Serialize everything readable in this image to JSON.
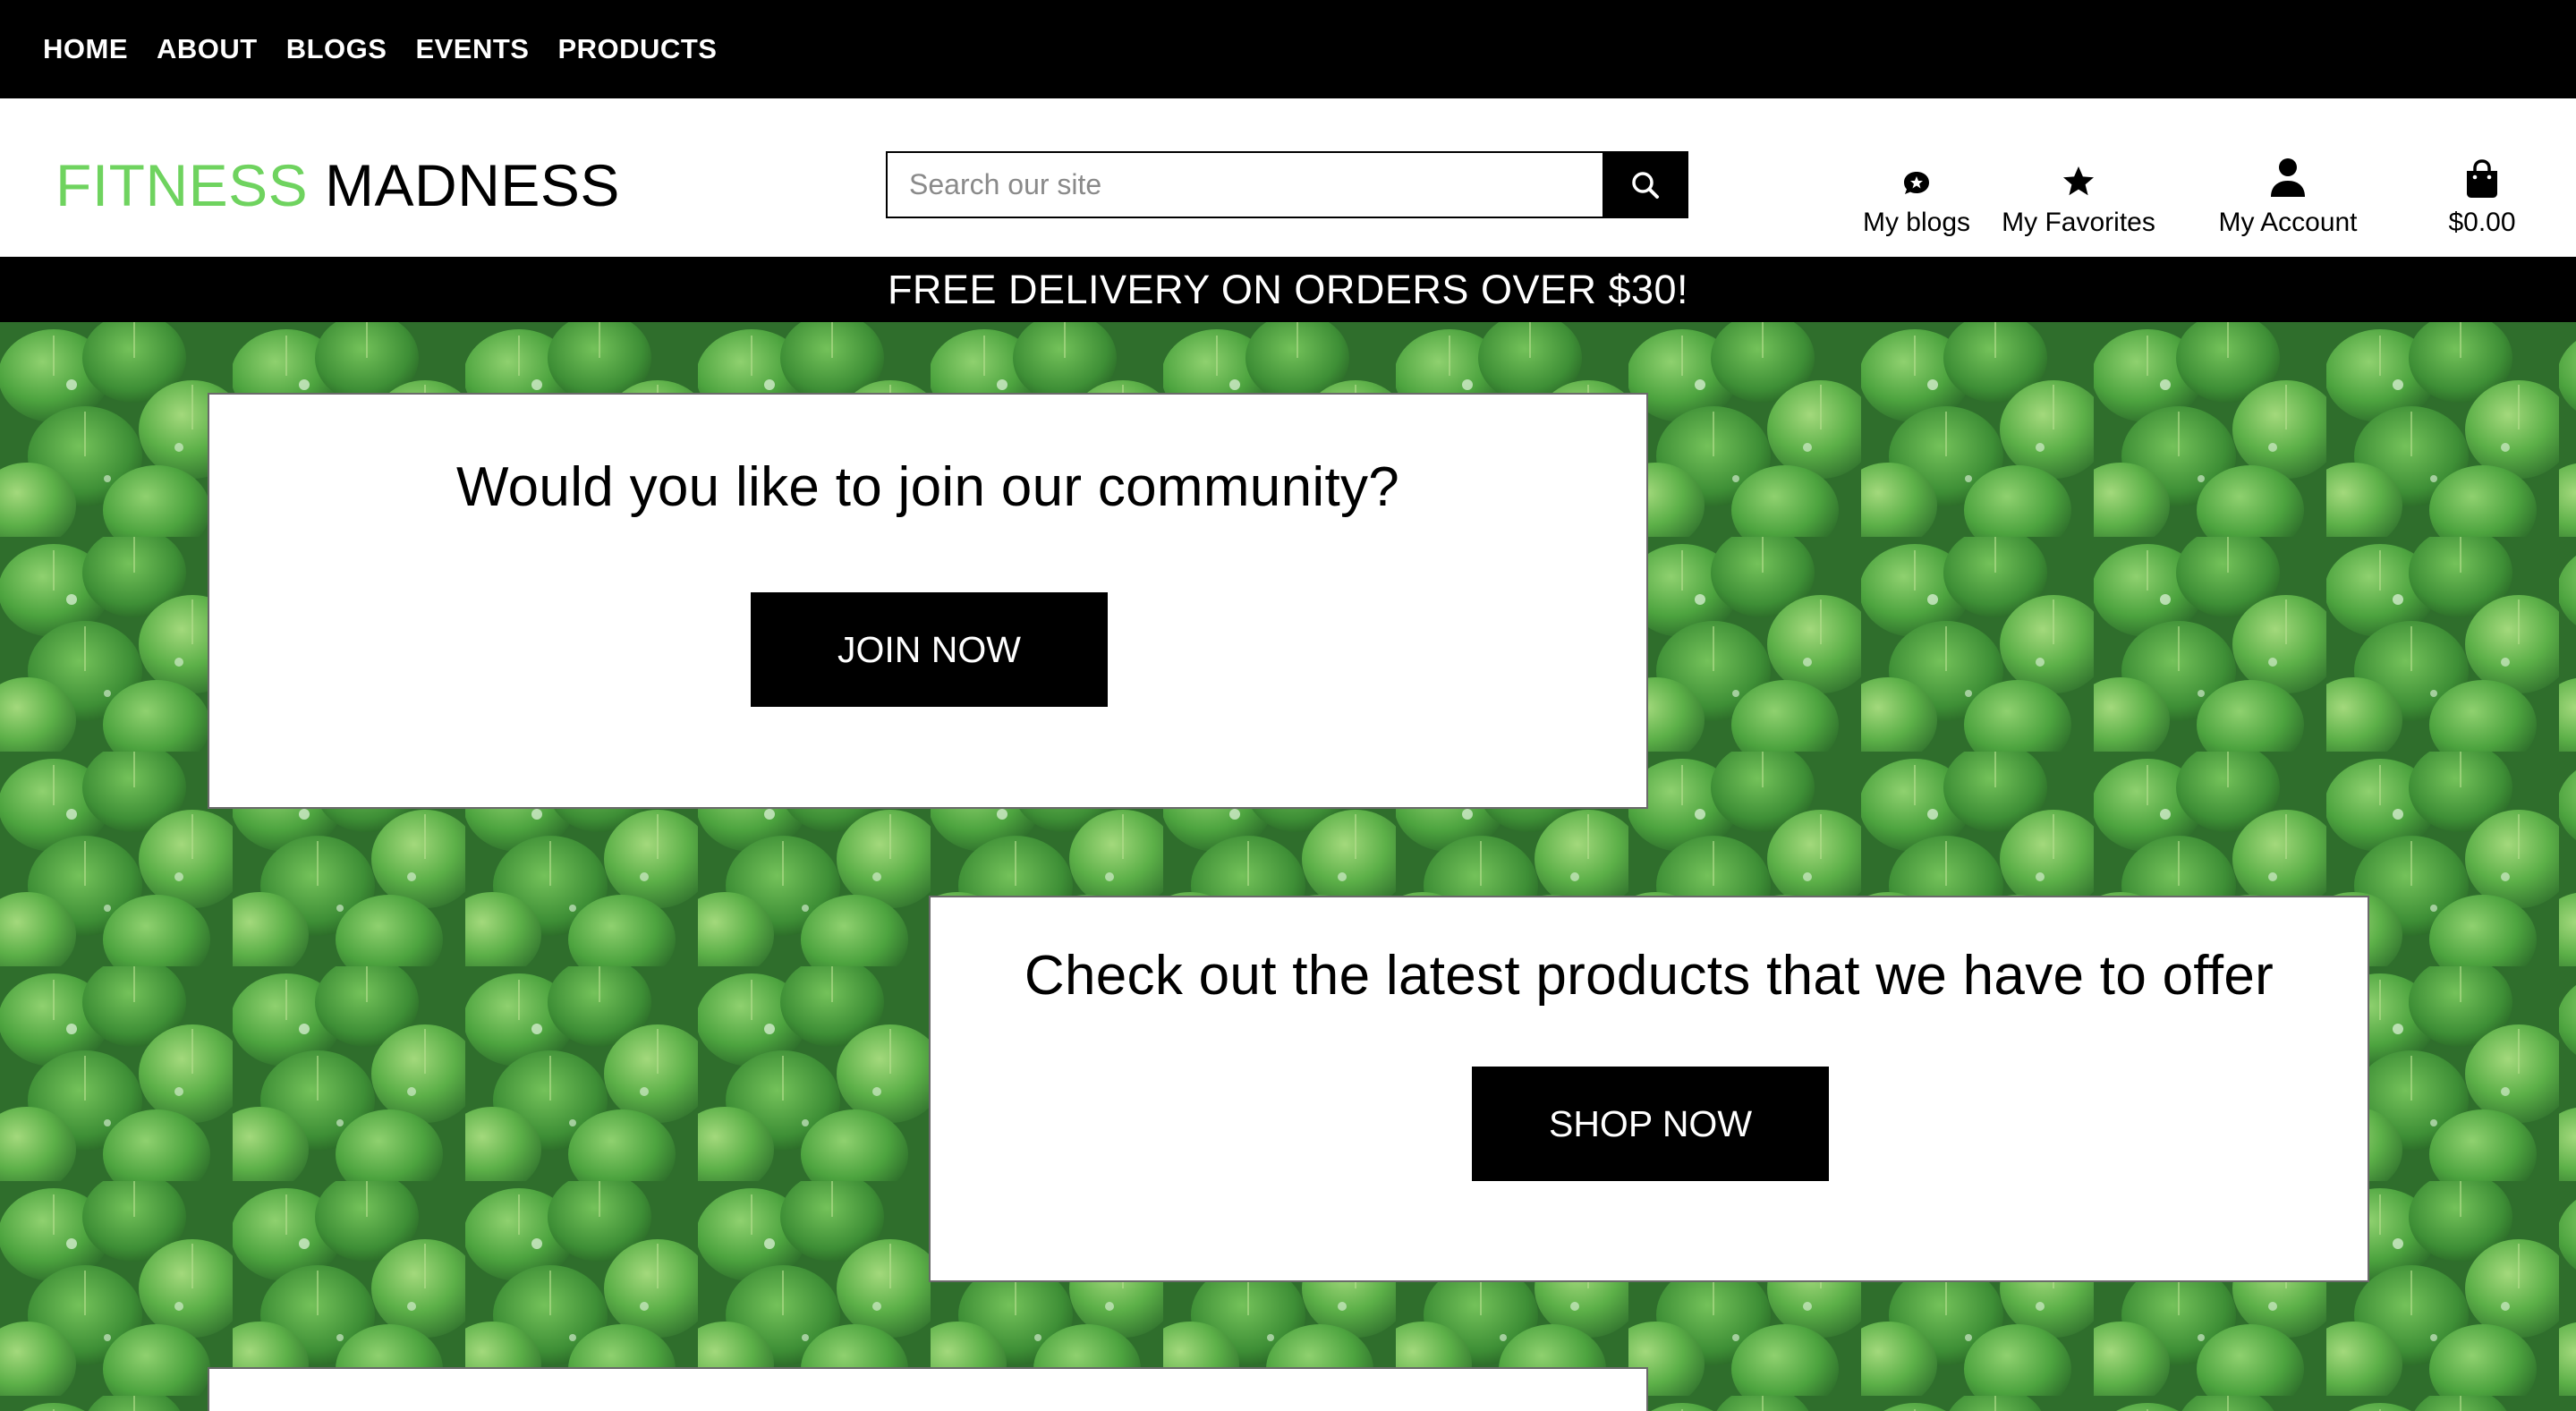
{
  "nav": {
    "items": [
      "HOME",
      "ABOUT",
      "BLOGS",
      "EVENTS",
      "PRODUCTS"
    ]
  },
  "logo": {
    "part1": "FITNESS",
    "part2": "MADNESS"
  },
  "search": {
    "placeholder": "Search our site",
    "value": ""
  },
  "header_links": {
    "blogs": "My blogs",
    "favorites": "My Favorites",
    "account": "My Account",
    "cart": "$0.00"
  },
  "banner": "FREE DELIVERY ON ORDERS OVER $30!",
  "cards": {
    "community": {
      "heading": "Would you like to join our community?",
      "button": "JOIN NOW"
    },
    "products": {
      "heading": "Check out the latest products that we have to offer",
      "button": "SHOP NOW"
    }
  },
  "colors": {
    "accent_green": "#6fd35f",
    "black": "#000000"
  },
  "icons": {
    "blogs": "chat-bubble-icon",
    "favorites": "star-icon",
    "account": "user-icon",
    "cart": "shopping-bag-icon",
    "search": "search-icon"
  }
}
